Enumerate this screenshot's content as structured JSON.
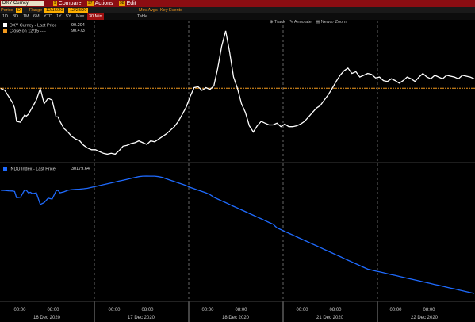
{
  "header": {
    "security_field": "DXY Curncy",
    "menu": [
      {
        "num": "9",
        "label": "Compare"
      },
      {
        "num": "97",
        "label": "Actions"
      },
      {
        "num": "98",
        "label": "Edit"
      }
    ]
  },
  "options": {
    "period_label": "Period",
    "period_value": "D",
    "range_label": "Range",
    "range_from": "12/16/20",
    "range_to": "12/23/20",
    "mov_avgs": "Mov Avgs",
    "key_events": "Key Events"
  },
  "range_buttons": [
    "1D",
    "3D",
    "1M",
    "6M",
    "YTD",
    "1Y",
    "5Y",
    "Max",
    "30 Min",
    "Table"
  ],
  "range_selected": "30 Min",
  "chart_tools": [
    "Track",
    "Annotate",
    "News",
    "Zoom"
  ],
  "colors": {
    "dxy": "#ffffff",
    "close_line": "#f39a1e",
    "indu": "#1f6bff",
    "grid": "#5a5a5a"
  },
  "chart_data": [
    {
      "type": "line",
      "legend": [
        {
          "name": "DXY Curncy - Last Price",
          "value": "90.204"
        },
        {
          "name": "Close on 12/15 ----",
          "value": "90.473"
        }
      ],
      "hline": 90.473,
      "ylim": [
        89.68,
        91.2
      ],
      "x": [
        0,
        2,
        4,
        6,
        7,
        8,
        10,
        12,
        13,
        14,
        15,
        16,
        18,
        20,
        22,
        24,
        26,
        28,
        29,
        30,
        32,
        34,
        36,
        38,
        40,
        42,
        44,
        46,
        48,
        50,
        52,
        54,
        56,
        58,
        60,
        62,
        64,
        66,
        68,
        70,
        72,
        74,
        76,
        78,
        80,
        82,
        84,
        86,
        88,
        90,
        92,
        94,
        96,
        98,
        100,
        102,
        104,
        106,
        108,
        110,
        112,
        114,
        116,
        118,
        120,
        122,
        124,
        126,
        128,
        130,
        132,
        134,
        136,
        138,
        140,
        142,
        144,
        146,
        148,
        150,
        152,
        154,
        156,
        158,
        160,
        162,
        164,
        166,
        168,
        170,
        172,
        174,
        176,
        178,
        180,
        182,
        184,
        186,
        188,
        190,
        192,
        194,
        196,
        198,
        200,
        202,
        204,
        206,
        208,
        210,
        212,
        214,
        216,
        218,
        220,
        222,
        224,
        226,
        228,
        230,
        232,
        234,
        236,
        238,
        240
      ],
      "series_dxy": [
        90.47,
        90.45,
        90.38,
        90.31,
        90.25,
        90.1,
        90.09,
        90.17,
        90.16,
        90.18,
        90.22,
        90.26,
        90.34,
        90.47,
        90.3,
        90.36,
        90.34,
        90.15,
        90.15,
        90.1,
        90.02,
        89.98,
        89.93,
        89.9,
        89.88,
        89.83,
        89.8,
        89.78,
        89.78,
        89.76,
        89.74,
        89.73,
        89.74,
        89.73,
        89.77,
        89.82,
        89.83,
        89.85,
        89.86,
        89.88,
        89.86,
        89.84,
        89.88,
        89.87,
        89.9,
        89.93,
        89.96,
        90.0,
        90.04,
        90.1,
        90.18,
        90.26,
        90.38,
        90.48,
        90.49,
        90.45,
        90.48,
        90.46,
        90.5,
        90.7,
        90.95,
        91.12,
        90.88,
        90.6,
        90.47,
        90.3,
        90.2,
        90.05,
        89.98,
        90.05,
        90.1,
        90.08,
        90.06,
        90.06,
        90.08,
        90.04,
        90.07,
        90.04,
        90.04,
        90.05,
        90.07,
        90.1,
        90.15,
        90.2,
        90.25,
        90.28,
        90.34,
        90.4,
        90.47,
        90.55,
        90.62,
        90.67,
        90.7,
        90.64,
        90.66,
        90.6,
        90.62,
        90.64,
        90.63,
        90.59,
        90.6,
        90.56,
        90.55,
        90.58,
        90.56,
        90.53,
        90.56,
        90.6,
        90.58,
        90.55,
        90.6,
        90.64,
        90.6,
        90.58,
        90.62,
        90.6,
        90.58,
        90.62,
        90.61,
        90.6,
        90.58,
        90.62,
        90.61,
        90.6,
        90.58
      ],
      "series_indu": [
        30179,
        30176,
        30172,
        30170,
        30165,
        30095,
        30100,
        30180,
        30177,
        30150,
        30155,
        30140,
        30150,
        30020,
        30040,
        30090,
        30080,
        30170,
        30179,
        30150,
        30160,
        30178,
        30185,
        30188,
        30190,
        30195,
        30200,
        30210,
        30220,
        30230,
        30240,
        30250,
        30260,
        30270,
        30280,
        30290,
        30300,
        30310,
        30320,
        30330,
        30335,
        30336,
        30335,
        30335,
        30330,
        30320,
        30305,
        30290,
        30275,
        30260,
        30245,
        30230,
        30210,
        30195,
        30180,
        30165,
        30150,
        30130,
        30100,
        30080,
        30060,
        30040,
        30020,
        30000,
        29980,
        29960,
        29940,
        29920,
        29900,
        29880,
        29860,
        29840,
        29820,
        29800,
        29760,
        29740,
        29720,
        29700,
        29680,
        29660,
        29640,
        29620,
        29600,
        29580,
        29560,
        29540,
        29520,
        29500,
        29480,
        29460,
        29440,
        29420,
        29400,
        29380,
        29360,
        29340,
        29320,
        29300,
        29290,
        29280,
        29270,
        29260,
        29250,
        29240,
        29230,
        29220,
        29210,
        29200,
        29190,
        29180,
        29170,
        29160,
        29150,
        29140,
        29130,
        29120,
        29110,
        29100,
        29090,
        29080,
        29070,
        29060,
        29050,
        29040,
        29030
      ],
      "x_ticks": [
        "00:00",
        "08:00",
        "00:00",
        "08:00",
        "00:00",
        "08:00",
        "00:00",
        "08:00",
        "00:00",
        "08:00",
        "00:00",
        "08:00",
        "00:00",
        "08:00"
      ],
      "dates": [
        "16 Dec 2020",
        "17 Dec 2020",
        "18 Dec 2020",
        "21 Dec 2020",
        "22 Dec 2020"
      ]
    },
    {
      "type": "line",
      "legend": [
        {
          "name": "INDU Index - Last Price",
          "value": "30179.64"
        }
      ]
    }
  ]
}
